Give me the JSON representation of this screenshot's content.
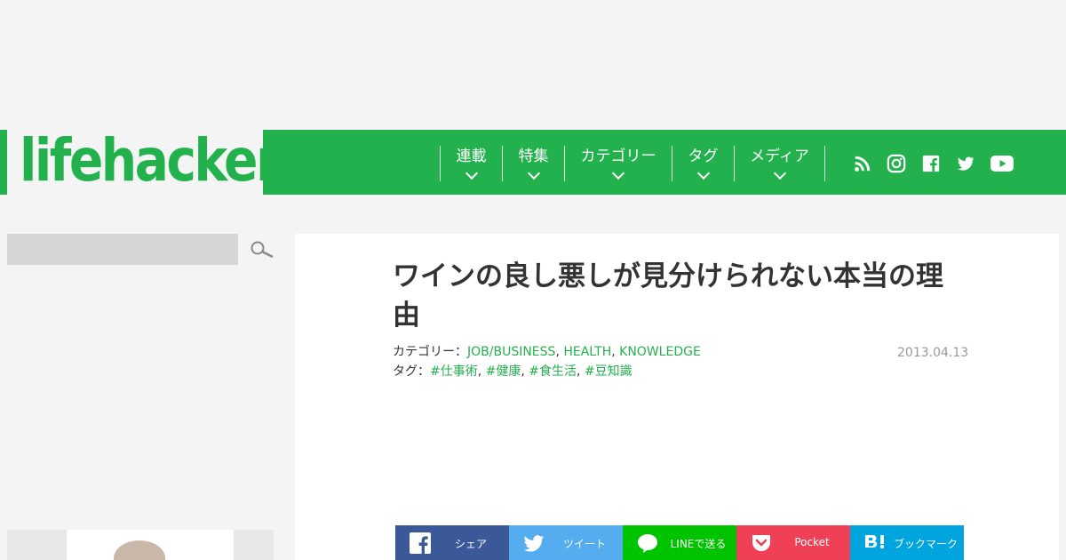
{
  "site": {
    "logo_text": "lifehacker"
  },
  "nav": {
    "items": [
      {
        "label": "連載"
      },
      {
        "label": "特集"
      },
      {
        "label": "カテゴリー"
      },
      {
        "label": "タグ"
      },
      {
        "label": "メディア"
      }
    ],
    "social": [
      "rss-icon",
      "instagram-icon",
      "facebook-icon",
      "twitter-icon",
      "youtube-icon"
    ]
  },
  "search": {
    "placeholder": ""
  },
  "article": {
    "title": "ワインの良し悪しが見分けられない本当の理由",
    "category_label": "カテゴリー：",
    "categories": [
      "JOB/BUSINESS",
      "HEALTH",
      "KNOWLEDGE"
    ],
    "tag_label": "タグ：",
    "tags": [
      "#仕事術",
      "#健康",
      "#食生活",
      "#豆知識"
    ],
    "date": "2013.04.13"
  },
  "share": [
    {
      "label": "シェア",
      "icon": "facebook-icon",
      "color": "#3b5998"
    },
    {
      "label": "ツイート",
      "icon": "twitter-icon",
      "color": "#55acee"
    },
    {
      "label": "LINEで送る",
      "icon": "line-icon",
      "color": "#00c300"
    },
    {
      "label": "Pocket",
      "icon": "pocket-icon",
      "color": "#ef4056"
    },
    {
      "label": "ブックマーク",
      "icon": "hatena-bookmark-icon",
      "color": "#00a4de"
    }
  ],
  "colors": {
    "brand": "#23b14d"
  }
}
